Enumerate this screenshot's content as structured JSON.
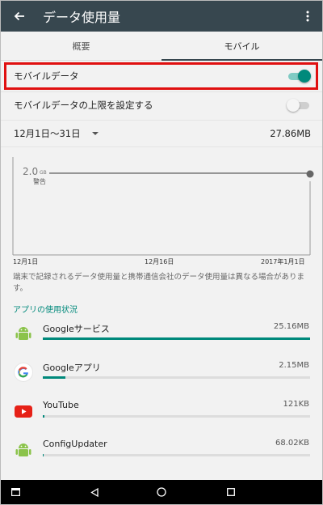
{
  "appbar": {
    "title": "データ使用量",
    "back_icon": "arrow-back-icon",
    "more_icon": "more-vert-icon"
  },
  "tabs": [
    {
      "label": "概要",
      "active": false
    },
    {
      "label": "モバイル",
      "active": true
    }
  ],
  "settings": {
    "mobile_data": {
      "label": "モバイルデータ",
      "enabled": true
    },
    "data_limit": {
      "label": "モバイルデータの上限を設定する",
      "enabled": false
    }
  },
  "period": {
    "label": "12月1日〜31日",
    "total": "27.86MB"
  },
  "chart_data": {
    "type": "line",
    "warning_value": "2.0",
    "warning_unit": "GB",
    "warning_label": "警告",
    "x_ticks": [
      "12月1日",
      "12月16日",
      "2017年1月1日"
    ]
  },
  "note": "端末で記録されるデータ使用量と携帯通信会社のデータ使用量は異なる場合があります。",
  "section_title": "アプリの使用状況",
  "apps": [
    {
      "name": "Googleサービス",
      "size": "25.16MB",
      "fraction": 1.0,
      "icon": "android-icon"
    },
    {
      "name": "Googleアプリ",
      "size": "2.15MB",
      "fraction": 0.085,
      "icon": "google-g-icon"
    },
    {
      "name": "YouTube",
      "size": "121KB",
      "fraction": 0.005,
      "icon": "youtube-icon"
    },
    {
      "name": "ConfigUpdater",
      "size": "68.02KB",
      "fraction": 0.003,
      "icon": "android-icon"
    }
  ],
  "colors": {
    "appbar": "#37474f",
    "accent": "#00897b",
    "highlight": "#e01010"
  }
}
